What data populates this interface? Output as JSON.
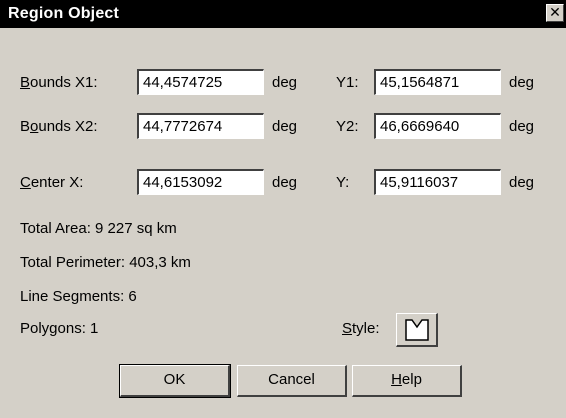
{
  "window": {
    "title": "Region Object"
  },
  "bounds_x1": {
    "mnemonic": "B",
    "label_rest": "ounds X1:",
    "value": "44,4574725",
    "unit": "deg"
  },
  "bounds_y1": {
    "label": "Y1:",
    "value": "45,1564871",
    "unit": "deg"
  },
  "bounds_x2": {
    "label_pre": "B",
    "mnemonic": "o",
    "label_rest": "unds X2:",
    "value": "44,7772674",
    "unit": "deg"
  },
  "bounds_y2": {
    "label": "Y2:",
    "value": "46,6669640",
    "unit": "deg"
  },
  "center_x": {
    "mnemonic": "C",
    "label_rest": "enter X:",
    "value": "44,6153092",
    "unit": "deg"
  },
  "center_y": {
    "label": "Y:",
    "value": "45,9116037",
    "unit": "deg"
  },
  "info": {
    "total_area": "Total Area:  9 227 sq km",
    "total_perimeter": "Total Perimeter:  403,3 km",
    "line_segments": "Line Segments:  6",
    "polygons": "Polygons:  1"
  },
  "style": {
    "mnemonic": "S",
    "label_rest": "tyle:",
    "icon": "region-style-swatch"
  },
  "buttons": {
    "ok": "OK",
    "cancel": "Cancel",
    "help_mnemonic": "H",
    "help_rest": "elp"
  }
}
